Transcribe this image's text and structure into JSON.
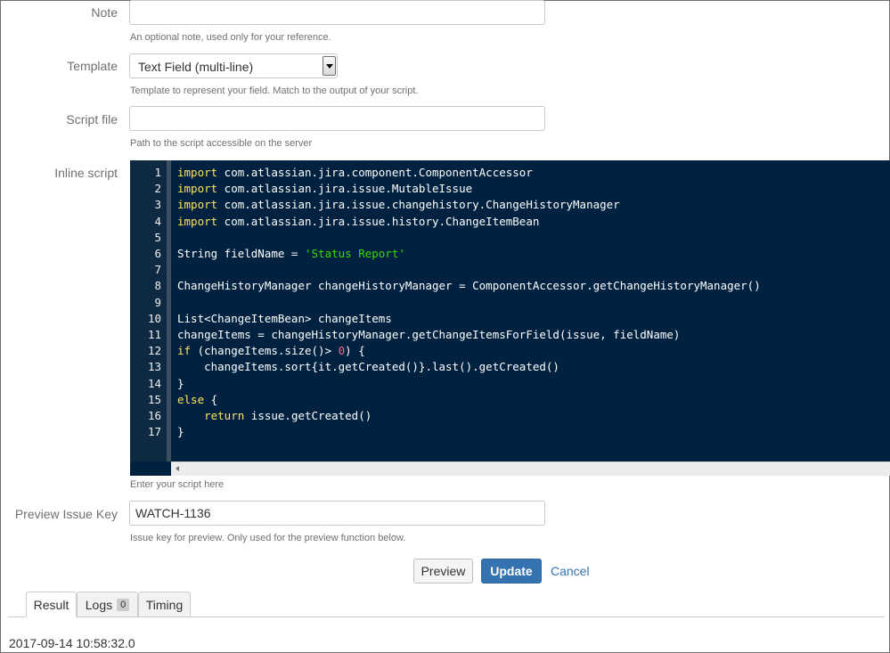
{
  "note": {
    "label": "Note",
    "value": "",
    "help": "An optional note, used only for your reference."
  },
  "template": {
    "label": "Template",
    "selected": "Text Field (multi-line)",
    "help": "Template to represent your field. Match to the output of your script."
  },
  "script_file": {
    "label": "Script file",
    "value": "",
    "help": "Path to the script accessible on the server"
  },
  "inline_script": {
    "label": "Inline script",
    "help": "Enter your script here",
    "line_numbers": [
      "1",
      "2",
      "3",
      "4",
      "5",
      "6",
      "7",
      "8",
      "9",
      "10",
      "11",
      "12",
      "13",
      "14",
      "15",
      "16",
      "17"
    ],
    "lines": [
      [
        {
          "t": "import",
          "c": "kw"
        },
        {
          "t": " com.atlassian.jira.component.ComponentAccessor",
          "c": ""
        }
      ],
      [
        {
          "t": "import",
          "c": "kw"
        },
        {
          "t": " com.atlassian.jira.issue.MutableIssue",
          "c": ""
        }
      ],
      [
        {
          "t": "import",
          "c": "kw"
        },
        {
          "t": " com.atlassian.jira.issue.changehistory.ChangeHistoryManager",
          "c": ""
        }
      ],
      [
        {
          "t": "import",
          "c": "kw"
        },
        {
          "t": " com.atlassian.jira.issue.history.ChangeItemBean",
          "c": ""
        }
      ],
      [],
      [
        {
          "t": "String fieldName = ",
          "c": ""
        },
        {
          "t": "'Status Report'",
          "c": "str"
        }
      ],
      [],
      [
        {
          "t": "ChangeHistoryManager changeHistoryManager = ComponentAccessor.getChangeHistoryManager()",
          "c": ""
        }
      ],
      [],
      [
        {
          "t": "List<ChangeItemBean> changeItems",
          "c": ""
        }
      ],
      [
        {
          "t": "changeItems = changeHistoryManager.getChangeItemsForField(issue, fieldName)",
          "c": ""
        }
      ],
      [
        {
          "t": "if",
          "c": "kw"
        },
        {
          "t": " (changeItems.size()> ",
          "c": ""
        },
        {
          "t": "0",
          "c": "num"
        },
        {
          "t": ") {",
          "c": ""
        }
      ],
      [
        {
          "t": "    changeItems.sort{it.getCreated()}.last().getCreated()",
          "c": ""
        }
      ],
      [
        {
          "t": "}",
          "c": ""
        }
      ],
      [
        {
          "t": "else",
          "c": "kw"
        },
        {
          "t": " {",
          "c": ""
        }
      ],
      [
        {
          "t": "    ",
          "c": ""
        },
        {
          "t": "return",
          "c": "kw"
        },
        {
          "t": " issue.getCreated()",
          "c": ""
        }
      ],
      [
        {
          "t": "}",
          "c": ""
        }
      ]
    ]
  },
  "preview_issue_key": {
    "label": "Preview Issue Key",
    "value": "WATCH-1136",
    "help": "Issue key for preview. Only used for the preview function below."
  },
  "actions": {
    "preview": "Preview",
    "update": "Update",
    "cancel": "Cancel"
  },
  "tabs": {
    "result": "Result",
    "logs": "Logs",
    "logs_count": "0",
    "timing": "Timing"
  },
  "result_text": "2017-09-14 10:58:32.0"
}
